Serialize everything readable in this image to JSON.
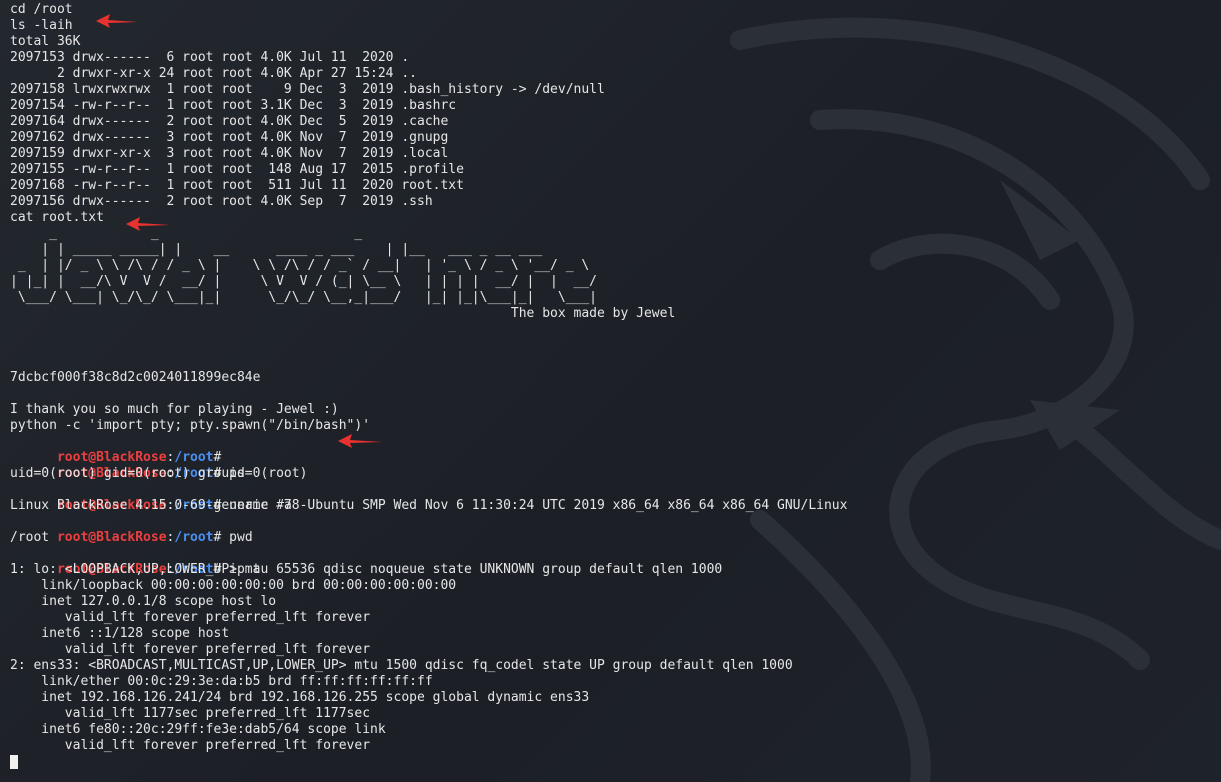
{
  "prompt": {
    "user_host": "root@BlackRose",
    "sep": ":",
    "path": "/root",
    "hash": "#"
  },
  "lines": [
    "cd /root",
    "ls -laih",
    "total 36K",
    "2097153 drwx------  6 root root 4.0K Jul 11  2020 .",
    "      2 drwxr-xr-x 24 root root 4.0K Apr 27 15:24 ..",
    "2097158 lrwxrwxrwx  1 root root    9 Dec  3  2019 .bash_history -> /dev/null",
    "2097154 -rw-r--r--  1 root root 3.1K Dec  3  2019 .bashrc",
    "2097164 drwx------  2 root root 4.0K Dec  5  2019 .cache",
    "2097162 drwx------  3 root root 4.0K Nov  7  2019 .gnupg",
    "2097159 drwxr-xr-x  3 root root 4.0K Nov  7  2019 .local",
    "2097155 -rw-r--r--  1 root root  148 Aug 17  2015 .profile",
    "2097168 -rw-r--r--  1 root root  511 Jul 11  2020 root.txt",
    "2097156 drwx------  2 root root 4.0K Sep  7  2019 .ssh",
    "cat root.txt",
    "     _            _                         _",
    "    | | _____ _____| |    __      ____ _ ___    | |__   ___ _ __ ___",
    " _  | |/ _ \\ \\ /\\ / / _ \\ |    \\ \\ /\\ / / _` / __|   | '_ \\ / _ \\ '__/ _ \\",
    "| |_| |  __/\\ V  V /  __/ |     \\ V  V / (_| \\__ \\   | | | |  __/ |  |  __/",
    " \\___/ \\___| \\_/\\_/ \\___|_|      \\_/\\_/ \\__,_|___/   |_| |_|\\___|_|   \\___|",
    "                                                                The box made by Jewel",
    "",
    "",
    "",
    "7dcbcf000f38c8d2c0024011899ec84e",
    "",
    "I thank you so much for playing - Jewel :)",
    "python -c 'import pty; pty.spawn(\"/bin/bash\")'",
    "uid=0(root) gid=0(root) groups=0(root)",
    "Linux BlackRose 4.15.0-69-generic #78-Ubuntu SMP Wed Nov 6 11:30:24 UTC 2019 x86_64 x86_64 x86_64 GNU/Linux",
    "/root",
    "1: lo: <LOOPBACK,UP,LOWER_UP> mtu 65536 qdisc noqueue state UNKNOWN group default qlen 1000",
    "    link/loopback 00:00:00:00:00:00 brd 00:00:00:00:00:00",
    "    inet 127.0.0.1/8 scope host lo",
    "       valid_lft forever preferred_lft forever",
    "    inet6 ::1/128 scope host",
    "       valid_lft forever preferred_lft forever",
    "2: ens33: <BROADCAST,MULTICAST,UP,LOWER_UP> mtu 1500 qdisc fq_codel state UP group default qlen 1000",
    "    link/ether 00:0c:29:3e:da:b5 brd ff:ff:ff:ff:ff:ff",
    "    inet 192.168.126.241/24 brd 192.168.126.255 scope global dynamic ens33",
    "       valid_lft 1177sec preferred_lft 1177sec",
    "    inet6 fe80::20c:29ff:fe3e:dab5/64 scope link",
    "       valid_lft forever preferred_lft forever"
  ],
  "commands": {
    "c1": "",
    "c2": " id",
    "c3": " uname -a",
    "c4": " pwd",
    "c5": " ip a"
  },
  "colors": {
    "background": "#1e2228",
    "text": "#e6e6e6",
    "user_host": "#ef3e3e",
    "path": "#4b8ff2",
    "annotation_arrow": "#e8322f"
  },
  "icons": [
    "red-arrow-icon",
    "dragon-logo-icon",
    "cursor-block-icon"
  ]
}
